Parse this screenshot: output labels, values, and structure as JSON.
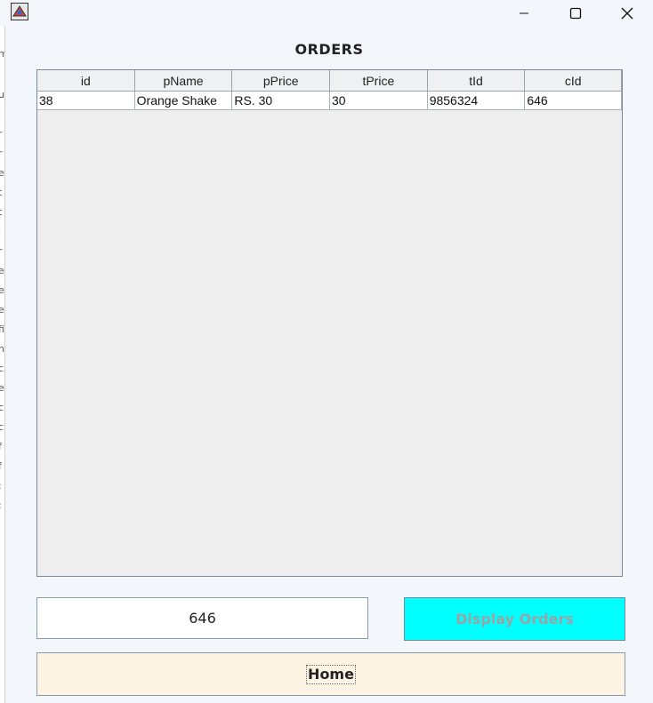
{
  "window": {
    "title": ""
  },
  "heading": "ORDERS",
  "table": {
    "columns": [
      "id",
      "pName",
      "pPrice",
      "tPrice",
      "tId",
      "cId"
    ],
    "rows": [
      [
        "38",
        "Orange Shake",
        "RS. 30",
        "30",
        "9856324",
        "646"
      ]
    ]
  },
  "search_input": {
    "value": "646"
  },
  "buttons": {
    "display_orders": "Display Orders",
    "home": "Home"
  },
  "background_window_chars": [
    "m",
    "u",
    "l",
    "r",
    "r",
    "e",
    "t",
    "t",
    "i",
    "r",
    "e",
    "e",
    "e",
    "fi",
    "h",
    "c",
    "e",
    "c",
    "c",
    "f",
    "f",
    ":",
    ":"
  ],
  "colors": {
    "display_button_bg": "#00ffff",
    "home_button_bg": "#fcf3e2",
    "window_bg": "#f3f6fb"
  },
  "icons": {
    "app": "java-app-icon",
    "minimize": "minimize-icon",
    "maximize": "maximize-icon",
    "close": "close-icon"
  }
}
